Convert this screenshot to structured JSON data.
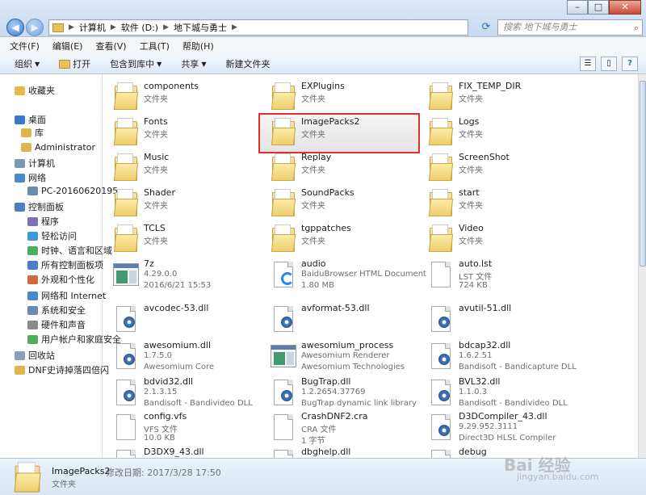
{
  "window": {
    "min": "–",
    "max": "□",
    "close": "✕"
  },
  "address": {
    "crumbs": [
      "计算机",
      "软件 (D:)",
      "地下城与勇士"
    ]
  },
  "search": {
    "placeholder": "搜索 地下城与勇士"
  },
  "menu": [
    "文件(F)",
    "编辑(E)",
    "查看(V)",
    "工具(T)",
    "帮助(H)"
  ],
  "toolbar": {
    "organize": "组织",
    "open": "打开",
    "include": "包含到库中",
    "share": "共享",
    "new_folder": "新建文件夹"
  },
  "nav": [
    {
      "label": "收藏夹",
      "color": "#e8b84a"
    },
    {
      "label": "桌面",
      "color": "#3b78c9"
    },
    {
      "label": "库",
      "color": "#e1b54d"
    },
    {
      "label": "Administrator",
      "color": "#e1b54d"
    },
    {
      "label": "计算机",
      "color": "#7a97b8"
    },
    {
      "label": "网络",
      "color": "#4a8acb"
    },
    {
      "label": "PC-20160620195",
      "color": "#6a8bb0"
    },
    {
      "label": "控制面板",
      "color": "#4a7fc4"
    },
    {
      "label": "程序",
      "color": "#7d6fb8"
    },
    {
      "label": "轻松访问",
      "color": "#3c9ad8"
    },
    {
      "label": "时钟、语言和区域",
      "color": "#4bae5a"
    },
    {
      "label": "所有控制面板项",
      "color": "#4a7fc4"
    },
    {
      "label": "外观和个性化",
      "color": "#d06a3a"
    },
    {
      "label": "网络和 Internet",
      "color": "#4a8acb"
    },
    {
      "label": "系统和安全",
      "color": "#6a8bb0"
    },
    {
      "label": "硬件和声音",
      "color": "#8a8a8a"
    },
    {
      "label": "用户帐户和家庭安全",
      "color": "#4bae5a"
    },
    {
      "label": "回收站",
      "color": "#8aa0b8"
    },
    {
      "label": "DNF史诗掉落四倍闪",
      "color": "#e1b54d"
    }
  ],
  "files": [
    {
      "name": "components",
      "l2": "文件夹",
      "type": "folder"
    },
    {
      "name": "EXPlugins",
      "l2": "文件夹",
      "type": "folder"
    },
    {
      "name": "FIX_TEMP_DIR",
      "l2": "文件夹",
      "type": "folder"
    },
    {
      "name": "Fonts",
      "l2": "文件夹",
      "type": "folder"
    },
    {
      "name": "ImagePacks2",
      "l2": "文件夹",
      "type": "folder",
      "selected": true
    },
    {
      "name": "Logs",
      "l2": "文件夹",
      "type": "folder"
    },
    {
      "name": "Music",
      "l2": "文件夹",
      "type": "folder"
    },
    {
      "name": "Replay",
      "l2": "文件夹",
      "type": "folder"
    },
    {
      "name": "ScreenShot",
      "l2": "文件夹",
      "type": "folder"
    },
    {
      "name": "Shader",
      "l2": "文件夹",
      "type": "folder"
    },
    {
      "name": "SoundPacks",
      "l2": "文件夹",
      "type": "folder"
    },
    {
      "name": "start",
      "l2": "文件夹",
      "type": "folder"
    },
    {
      "name": "TCLS",
      "l2": "文件夹",
      "type": "folder"
    },
    {
      "name": "tgppatches",
      "l2": "文件夹",
      "type": "folder"
    },
    {
      "name": "Video",
      "l2": "文件夹",
      "type": "folder"
    },
    {
      "name": "7z",
      "l2": "4.29.0.0",
      "l3": "2016/6/21 15:53",
      "type": "app"
    },
    {
      "name": "audio",
      "l2": "BaiduBrowser HTML Document",
      "l3": "1.80 MB",
      "type": "baidu"
    },
    {
      "name": "auto.lst",
      "l2": "LST 文件",
      "l3": "724 KB",
      "type": "file"
    },
    {
      "name": "avcodec-53.dll",
      "type": "dll"
    },
    {
      "name": "avformat-53.dll",
      "type": "dll"
    },
    {
      "name": "avutil-51.dll",
      "type": "dll"
    },
    {
      "name": "awesomium.dll",
      "l2": "1.7.5.0",
      "l3": "Awesomium Core",
      "type": "dll"
    },
    {
      "name": "awesomium_process",
      "l2": "Awesomium Renderer",
      "l3": "Awesomium Technologies",
      "type": "app"
    },
    {
      "name": "bdcap32.dll",
      "l2": "1.6.2.51",
      "l3": "Bandisoft - Bandicapture DLL",
      "type": "dll"
    },
    {
      "name": "bdvid32.dll",
      "l2": "2.1.3.15",
      "l3": "Bandisoft - Bandivideo DLL",
      "type": "dll"
    },
    {
      "name": "BugTrap.dll",
      "l2": "1.2.2654.37769",
      "l3": "BugTrap dynamic link library",
      "type": "dll"
    },
    {
      "name": "BVL32.dll",
      "l2": "1.1.0.3",
      "l3": "Bandisoft - Bandivideo DLL",
      "type": "dll"
    },
    {
      "name": "config.vfs",
      "l2": "VFS 文件",
      "l3": "10.0 KB",
      "type": "file"
    },
    {
      "name": "CrashDNF2.cra",
      "l2": "CRA 文件",
      "l3": "1 字节",
      "type": "file"
    },
    {
      "name": "D3DCompiler_43.dll",
      "l2": "9.29.952.3111",
      "l3": "Direct3D HLSL Compiler",
      "type": "dll"
    },
    {
      "name": "D3DX9_43.dll",
      "type": "dll"
    },
    {
      "name": "dbghelp.dll",
      "type": "dll"
    },
    {
      "name": "debug",
      "type": "file"
    }
  ],
  "details": {
    "name": "ImagePacks2",
    "modified": "修改日期: 2017/3/28 17:50",
    "type": "文件夹"
  },
  "watermark": {
    "text": "Bai 经验",
    "sub": "jingyan.baidu.com"
  }
}
